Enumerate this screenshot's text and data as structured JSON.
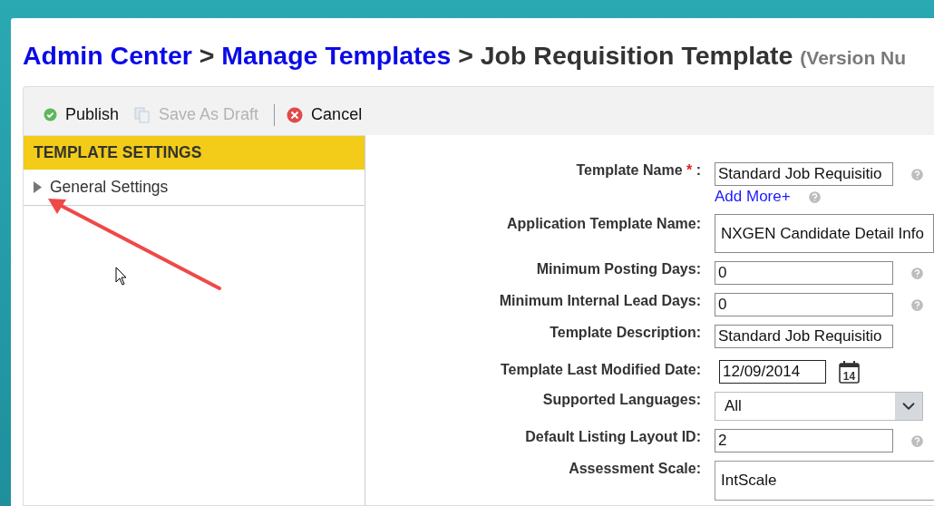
{
  "breadcrumb": {
    "links": [
      "Admin Center",
      "Manage Templates"
    ],
    "separator": ">",
    "current": "Job Requisition Template",
    "note": "(Version Nu"
  },
  "toolbar": [
    {
      "kind": "publish",
      "label": "Publish",
      "disabled": false
    },
    {
      "kind": "draft",
      "label": "Save As Draft",
      "disabled": true
    },
    {
      "kind": "cancel",
      "label": "Cancel",
      "disabled": false
    }
  ],
  "sidebar": {
    "header": "TEMPLATE SETTINGS",
    "items": [
      {
        "label": "General Settings",
        "expanded": false
      }
    ]
  },
  "form": [
    {
      "label": "Template Name",
      "required_mark": "*",
      "label_end": ":",
      "kind": "text",
      "value": "Standard Job Requisitio",
      "help": true,
      "link": "Add More+",
      "link_help": true
    },
    {
      "label": "Application Template Name:",
      "kind": "wide",
      "value": "NXGEN Candidate Detail Info"
    },
    {
      "label": "Minimum Posting Days:",
      "kind": "text",
      "value": "0",
      "help": true
    },
    {
      "label": "Minimum Internal Lead Days:",
      "kind": "text",
      "value": "0",
      "help": true
    },
    {
      "label": "Template Description:",
      "kind": "text",
      "value": "Standard Job Requisitio",
      "help": false
    },
    {
      "label": "Template Last Modified Date:",
      "kind": "date",
      "value": "12/09/2014",
      "calendar_day": "14"
    },
    {
      "label": "Supported Languages:",
      "kind": "select",
      "value": "All"
    },
    {
      "label": "Default Listing Layout ID:",
      "kind": "text",
      "value": "2",
      "help": true
    },
    {
      "label": "Assessment Scale:",
      "kind": "wideselect",
      "value": "IntScale"
    }
  ]
}
